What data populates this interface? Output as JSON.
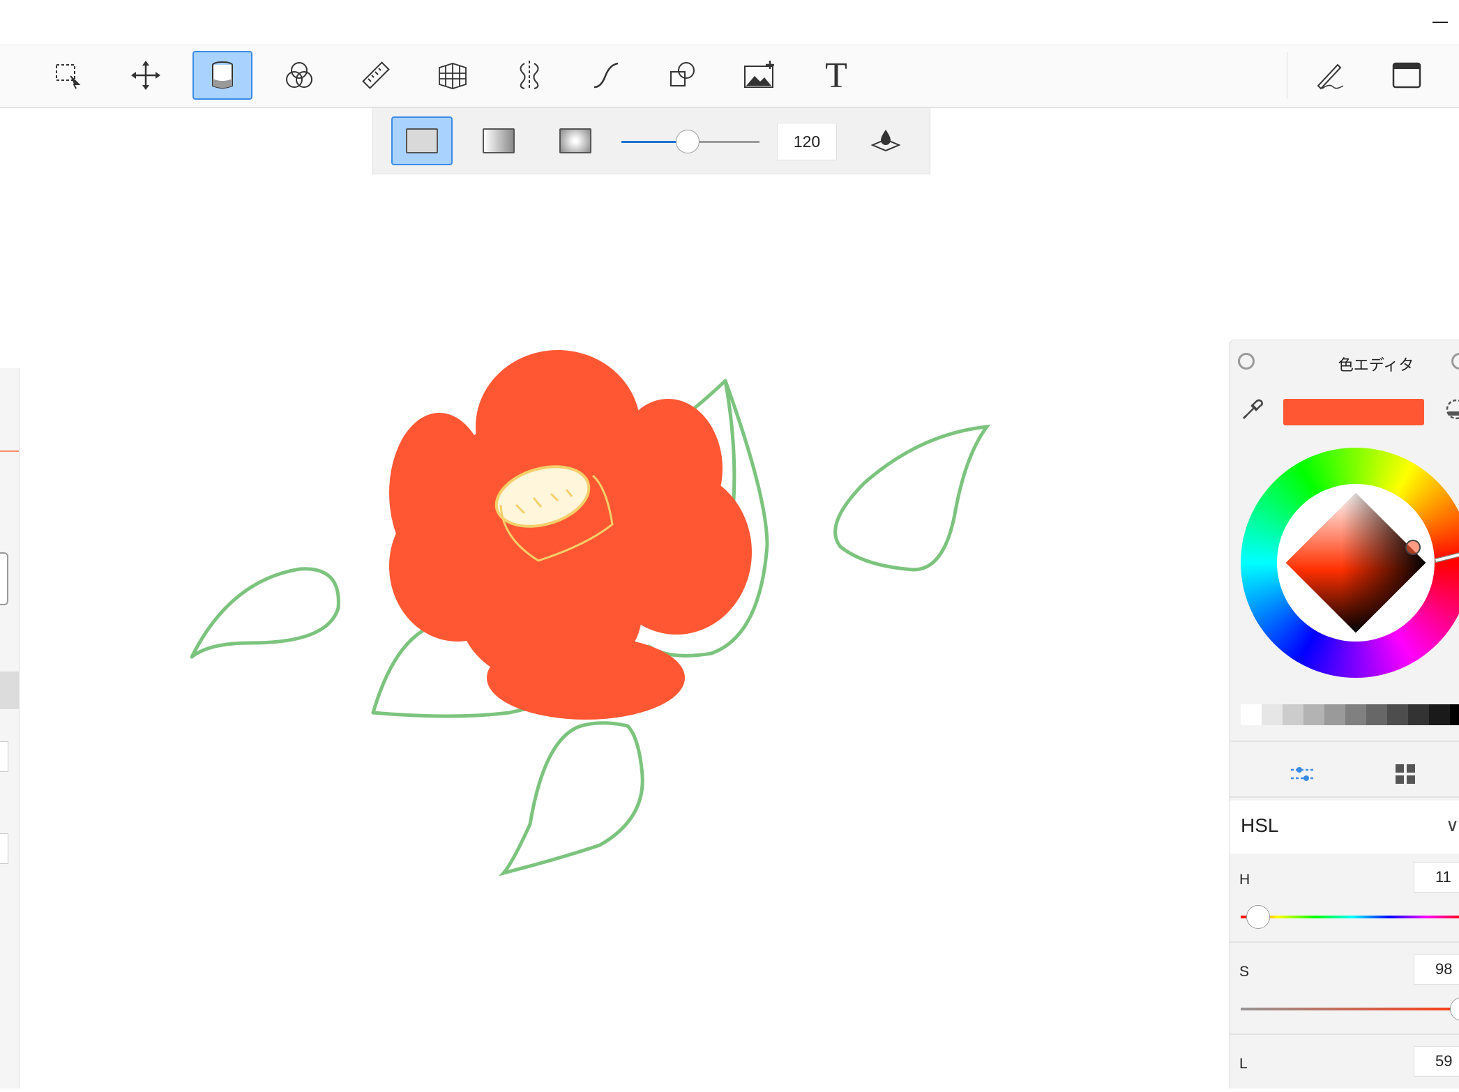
{
  "toolbar": {
    "tools": [
      {
        "name": "selection-tool",
        "icon": "lasso-select-icon"
      },
      {
        "name": "transform-tool",
        "icon": "move-arrows-icon"
      },
      {
        "name": "fill-tool",
        "icon": "paint-bucket-icon",
        "selected": true
      },
      {
        "name": "blend-tool",
        "icon": "blend-circles-icon"
      },
      {
        "name": "ruler-tool",
        "icon": "ruler-icon"
      },
      {
        "name": "perspective-tool",
        "icon": "perspective-grid-icon"
      },
      {
        "name": "symmetry-tool",
        "icon": "symmetry-icon"
      },
      {
        "name": "curve-tool",
        "icon": "curve-stroke-icon"
      },
      {
        "name": "shape-tool",
        "icon": "shapes-icon"
      },
      {
        "name": "image-tool",
        "icon": "add-image-icon"
      },
      {
        "name": "text-tool",
        "icon": "text-icon",
        "label": "T"
      }
    ],
    "right": [
      {
        "name": "pen-mode",
        "icon": "pen-icon"
      },
      {
        "name": "window-mode",
        "icon": "window-icon"
      }
    ]
  },
  "fill_options": {
    "modes": [
      "flat-fill",
      "linear-fill",
      "radial-fill"
    ],
    "selected_mode": "flat-fill",
    "tolerance": 120,
    "tolerance_text": "120",
    "slider_fraction": 0.48
  },
  "color_editor": {
    "title": "色エディタ",
    "current_color": "#ff5733",
    "palette": [
      "#ffffff",
      "#e6e6e6",
      "#cccccc",
      "#b3b3b3",
      "#9a9a9a",
      "#808080",
      "#676767",
      "#4d4d4d",
      "#333333",
      "#1a1a1a",
      "#000000"
    ],
    "model": "HSL",
    "channels": [
      {
        "label": "H",
        "value": "11"
      },
      {
        "label": "S",
        "value": "98"
      },
      {
        "label": "L",
        "value": "59"
      }
    ]
  },
  "colors": {
    "accent": "#1e73d2",
    "selected_bg": "#a9d2ff",
    "petal": "#ff5733",
    "leaf": "#7cc47e",
    "stamen": "#f5cf6a"
  }
}
